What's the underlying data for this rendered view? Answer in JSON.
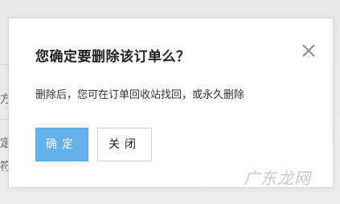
{
  "dialog": {
    "title": "您确定要删除该订单么？",
    "message": "删除后，您可在订单回收站找回，或永久删除",
    "confirm_label": "确定",
    "close_label": "关闭",
    "close_icon": "close-icon"
  },
  "background": {
    "fragments": [
      "方",
      "定(",
      "符"
    ]
  },
  "watermark": "广东龙网",
  "colors": {
    "primary": "#64b2ec",
    "overlay": "#ececec",
    "text": "#222222"
  }
}
